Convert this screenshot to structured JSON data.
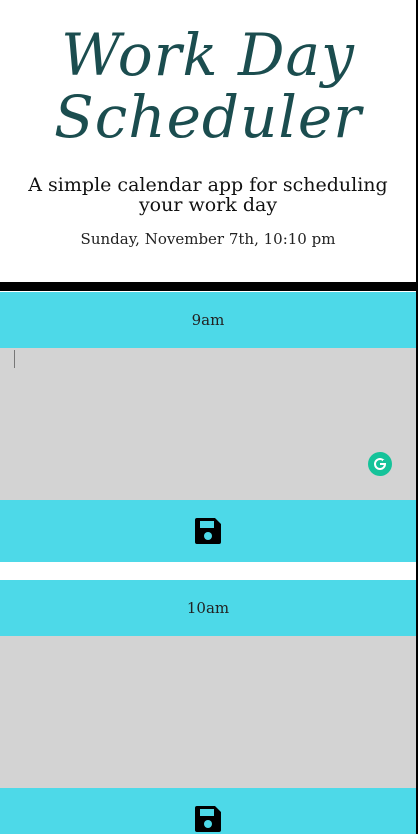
{
  "header": {
    "title": "Work Day Scheduler",
    "subtitle": "A simple calendar app for scheduling your work day",
    "current_date": "Sunday, November 7th, 10:10 pm"
  },
  "blocks": [
    {
      "hour": "9am",
      "text": "",
      "save_icon": "floppy-disk-icon"
    },
    {
      "hour": "10am",
      "text": "",
      "save_icon": "floppy-disk-icon"
    }
  ],
  "colors": {
    "hour_bg": "#4dd9e8",
    "textarea_bg": "#d3d3d3",
    "title_color": "#1b4d4f",
    "grammarly": "#15c39a"
  }
}
